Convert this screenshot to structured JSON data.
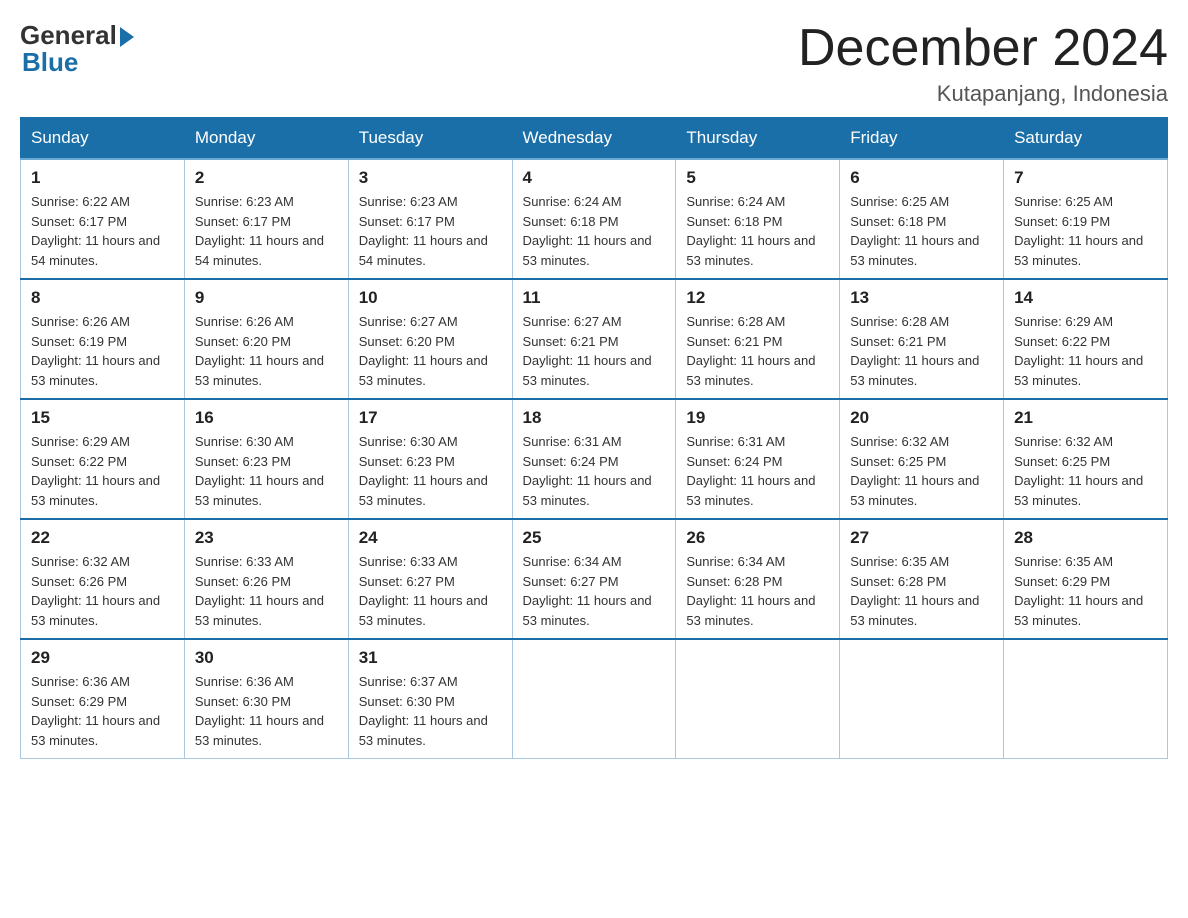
{
  "logo": {
    "general": "General",
    "blue": "Blue"
  },
  "title": "December 2024",
  "subtitle": "Kutapanjang, Indonesia",
  "days_of_week": [
    "Sunday",
    "Monday",
    "Tuesday",
    "Wednesday",
    "Thursday",
    "Friday",
    "Saturday"
  ],
  "weeks": [
    [
      {
        "day": "1",
        "sunrise": "6:22 AM",
        "sunset": "6:17 PM",
        "daylight": "11 hours and 54 minutes."
      },
      {
        "day": "2",
        "sunrise": "6:23 AM",
        "sunset": "6:17 PM",
        "daylight": "11 hours and 54 minutes."
      },
      {
        "day": "3",
        "sunrise": "6:23 AM",
        "sunset": "6:17 PM",
        "daylight": "11 hours and 54 minutes."
      },
      {
        "day": "4",
        "sunrise": "6:24 AM",
        "sunset": "6:18 PM",
        "daylight": "11 hours and 53 minutes."
      },
      {
        "day": "5",
        "sunrise": "6:24 AM",
        "sunset": "6:18 PM",
        "daylight": "11 hours and 53 minutes."
      },
      {
        "day": "6",
        "sunrise": "6:25 AM",
        "sunset": "6:18 PM",
        "daylight": "11 hours and 53 minutes."
      },
      {
        "day": "7",
        "sunrise": "6:25 AM",
        "sunset": "6:19 PM",
        "daylight": "11 hours and 53 minutes."
      }
    ],
    [
      {
        "day": "8",
        "sunrise": "6:26 AM",
        "sunset": "6:19 PM",
        "daylight": "11 hours and 53 minutes."
      },
      {
        "day": "9",
        "sunrise": "6:26 AM",
        "sunset": "6:20 PM",
        "daylight": "11 hours and 53 minutes."
      },
      {
        "day": "10",
        "sunrise": "6:27 AM",
        "sunset": "6:20 PM",
        "daylight": "11 hours and 53 minutes."
      },
      {
        "day": "11",
        "sunrise": "6:27 AM",
        "sunset": "6:21 PM",
        "daylight": "11 hours and 53 minutes."
      },
      {
        "day": "12",
        "sunrise": "6:28 AM",
        "sunset": "6:21 PM",
        "daylight": "11 hours and 53 minutes."
      },
      {
        "day": "13",
        "sunrise": "6:28 AM",
        "sunset": "6:21 PM",
        "daylight": "11 hours and 53 minutes."
      },
      {
        "day": "14",
        "sunrise": "6:29 AM",
        "sunset": "6:22 PM",
        "daylight": "11 hours and 53 minutes."
      }
    ],
    [
      {
        "day": "15",
        "sunrise": "6:29 AM",
        "sunset": "6:22 PM",
        "daylight": "11 hours and 53 minutes."
      },
      {
        "day": "16",
        "sunrise": "6:30 AM",
        "sunset": "6:23 PM",
        "daylight": "11 hours and 53 minutes."
      },
      {
        "day": "17",
        "sunrise": "6:30 AM",
        "sunset": "6:23 PM",
        "daylight": "11 hours and 53 minutes."
      },
      {
        "day": "18",
        "sunrise": "6:31 AM",
        "sunset": "6:24 PM",
        "daylight": "11 hours and 53 minutes."
      },
      {
        "day": "19",
        "sunrise": "6:31 AM",
        "sunset": "6:24 PM",
        "daylight": "11 hours and 53 minutes."
      },
      {
        "day": "20",
        "sunrise": "6:32 AM",
        "sunset": "6:25 PM",
        "daylight": "11 hours and 53 minutes."
      },
      {
        "day": "21",
        "sunrise": "6:32 AM",
        "sunset": "6:25 PM",
        "daylight": "11 hours and 53 minutes."
      }
    ],
    [
      {
        "day": "22",
        "sunrise": "6:32 AM",
        "sunset": "6:26 PM",
        "daylight": "11 hours and 53 minutes."
      },
      {
        "day": "23",
        "sunrise": "6:33 AM",
        "sunset": "6:26 PM",
        "daylight": "11 hours and 53 minutes."
      },
      {
        "day": "24",
        "sunrise": "6:33 AM",
        "sunset": "6:27 PM",
        "daylight": "11 hours and 53 minutes."
      },
      {
        "day": "25",
        "sunrise": "6:34 AM",
        "sunset": "6:27 PM",
        "daylight": "11 hours and 53 minutes."
      },
      {
        "day": "26",
        "sunrise": "6:34 AM",
        "sunset": "6:28 PM",
        "daylight": "11 hours and 53 minutes."
      },
      {
        "day": "27",
        "sunrise": "6:35 AM",
        "sunset": "6:28 PM",
        "daylight": "11 hours and 53 minutes."
      },
      {
        "day": "28",
        "sunrise": "6:35 AM",
        "sunset": "6:29 PM",
        "daylight": "11 hours and 53 minutes."
      }
    ],
    [
      {
        "day": "29",
        "sunrise": "6:36 AM",
        "sunset": "6:29 PM",
        "daylight": "11 hours and 53 minutes."
      },
      {
        "day": "30",
        "sunrise": "6:36 AM",
        "sunset": "6:30 PM",
        "daylight": "11 hours and 53 minutes."
      },
      {
        "day": "31",
        "sunrise": "6:37 AM",
        "sunset": "6:30 PM",
        "daylight": "11 hours and 53 minutes."
      },
      null,
      null,
      null,
      null
    ]
  ]
}
